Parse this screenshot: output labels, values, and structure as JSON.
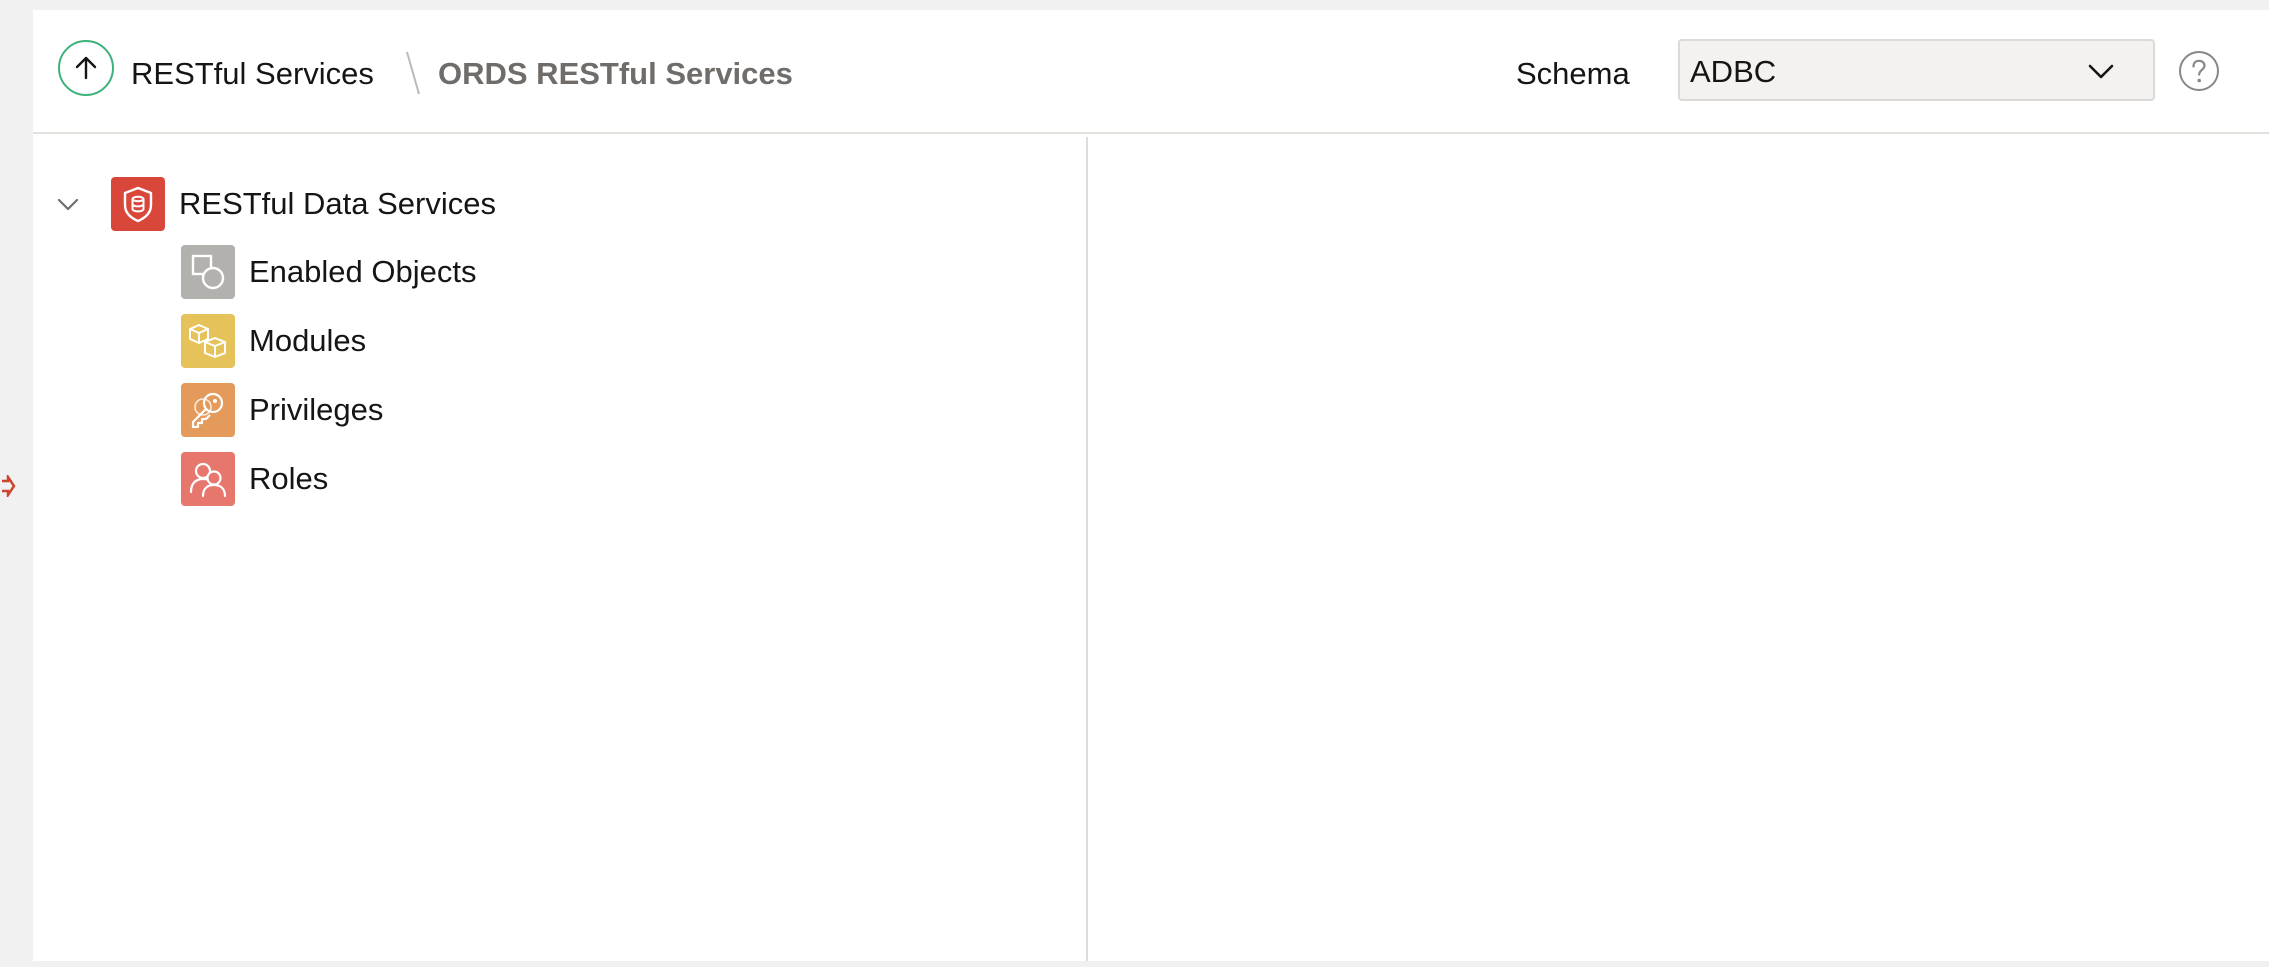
{
  "header": {
    "up_icon": "arrow-up-circle-icon",
    "breadcrumb_root": "RESTful Services",
    "breadcrumb_current": "ORDS RESTful Services",
    "schema_label": "Schema",
    "schema_value": "ADBC",
    "help_icon": "question-circle-icon"
  },
  "tree": {
    "root": {
      "label": "RESTful Data Services",
      "icon": "shield-database-icon",
      "expanded": true
    },
    "children": [
      {
        "label": "Enabled Objects",
        "icon": "shapes-icon",
        "color": "#b3b1ae"
      },
      {
        "label": "Modules",
        "icon": "cubes-icon",
        "color": "#e6c25a"
      },
      {
        "label": "Privileges",
        "icon": "keys-icon",
        "color": "#e39a5a"
      },
      {
        "label": "Roles",
        "icon": "users-icon",
        "color": "#e7766d"
      }
    ]
  },
  "colors": {
    "accent_green": "#3fb07a",
    "root_icon_red": "#d9473b"
  }
}
